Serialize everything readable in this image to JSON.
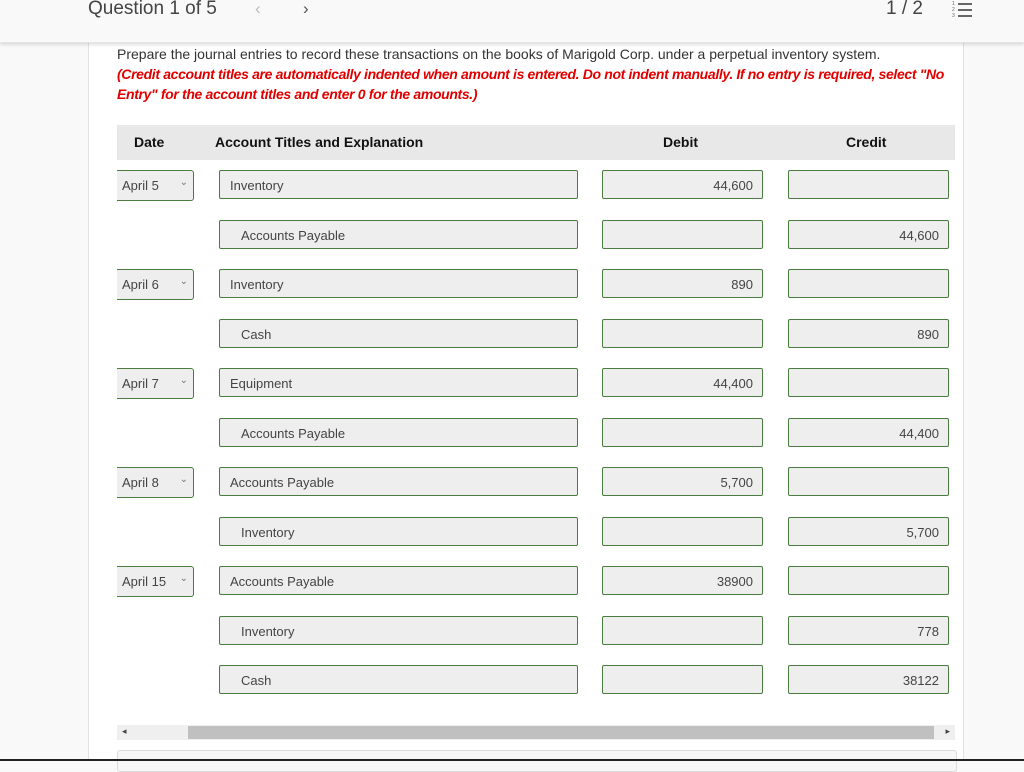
{
  "header": {
    "question_label": "Question 1 of 5",
    "prev_icon": "chevron-left-icon",
    "next_icon": "chevron-right-icon",
    "prev_glyph": "‹",
    "next_glyph": "›",
    "page_indicator": "1 / 2",
    "list_icon": "numbered-list-icon"
  },
  "prompt": {
    "text": "Prepare the journal entries to record these transactions on the books of Marigold Corp. under a perpetual inventory system.",
    "instruction": "(Credit account titles are automatically indented when amount is entered. Do not indent manually. If no entry is required, select \"No Entry\" for the account titles and enter 0 for the amounts.)"
  },
  "table": {
    "headers": {
      "date": "Date",
      "account": "Account Titles and Explanation",
      "debit": "Debit",
      "credit": "Credit"
    },
    "rows": [
      {
        "date": "April 5",
        "account": "Inventory",
        "debit": "44,600",
        "credit": ""
      },
      {
        "date": "",
        "account": "Accounts Payable",
        "debit": "",
        "credit": "44,600"
      },
      {
        "date": "April 6",
        "account": "Inventory",
        "debit": "890",
        "credit": ""
      },
      {
        "date": "",
        "account": "Cash",
        "debit": "",
        "credit": "890"
      },
      {
        "date": "April 7",
        "account": "Equipment",
        "debit": "44,400",
        "credit": ""
      },
      {
        "date": "",
        "account": "Accounts Payable",
        "debit": "",
        "credit": "44,400"
      },
      {
        "date": "April 8",
        "account": "Accounts Payable",
        "debit": "5,700",
        "credit": ""
      },
      {
        "date": "",
        "account": "Inventory",
        "debit": "",
        "credit": "5,700"
      },
      {
        "date": "April 15",
        "account": "Accounts Payable",
        "debit": "38900",
        "credit": ""
      },
      {
        "date": "",
        "account": "Inventory",
        "debit": "",
        "credit": "778"
      },
      {
        "date": "",
        "account": "Cash",
        "debit": "",
        "credit": "38122"
      }
    ]
  },
  "scrollbar": {
    "left_glyph": "◂",
    "right_glyph": "▸"
  },
  "colors": {
    "field_border": "#4a7c3f",
    "instruction_red": "#e00000",
    "header_bg": "#e8e8e8"
  }
}
